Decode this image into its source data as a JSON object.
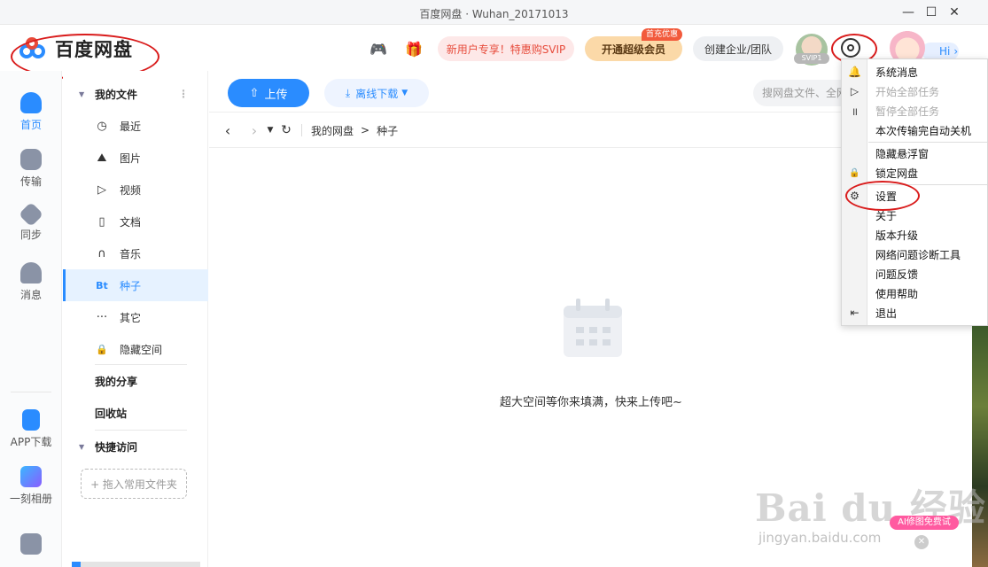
{
  "window": {
    "title": "百度网盘 · Wuhan_20171013"
  },
  "header": {
    "logo_text": "百度网盘",
    "promo_new_user": "新用户专享！特惠购SVIP",
    "svip_button": "开通超级会员",
    "svip_badge": "首充优惠",
    "enterprise_button": "创建企业/团队",
    "vip_level": "SVIP1",
    "hi_label": "Hi"
  },
  "left_nav": {
    "items": [
      {
        "label": "首页",
        "active": true
      },
      {
        "label": "传输"
      },
      {
        "label": "同步"
      },
      {
        "label": "消息"
      }
    ],
    "bottom_items": [
      {
        "label": "APP下载"
      },
      {
        "label": "一刻相册"
      }
    ]
  },
  "tree": {
    "my_files": "我的文件",
    "items": [
      {
        "label": "最近",
        "icon": "clock-icon",
        "glyph": "◷"
      },
      {
        "label": "图片",
        "icon": "image-icon",
        "glyph": "⛰"
      },
      {
        "label": "视频",
        "icon": "play-icon",
        "glyph": "▷"
      },
      {
        "label": "文档",
        "icon": "doc-icon",
        "glyph": "▯"
      },
      {
        "label": "音乐",
        "icon": "headphones-icon",
        "glyph": "∩"
      },
      {
        "label": "种子",
        "icon": "bt-icon",
        "glyph": "Bt",
        "selected": true
      },
      {
        "label": "其它",
        "icon": "more-icon",
        "glyph": "···"
      },
      {
        "label": "隐藏空间",
        "icon": "lock-icon",
        "glyph": "🔒"
      }
    ],
    "my_share": "我的分享",
    "recycle": "回收站",
    "quick_access": "快捷访问",
    "drop_hint": "+ 拖入常用文件夹"
  },
  "toolbar": {
    "upload": "上传",
    "offline_download": "离线下载",
    "search_placeholder": "搜网盘文件、全网"
  },
  "path": {
    "root": "我的网盘",
    "separator": ">",
    "current": "种子"
  },
  "empty": {
    "message": "超大空间等你来填满，快来上传吧~"
  },
  "menu": {
    "items": [
      {
        "label": "系统消息",
        "icon": "bell-icon",
        "glyph": "🔔",
        "disabled": false
      },
      {
        "label": "开始全部任务",
        "icon": "play-icon",
        "glyph": "▷",
        "disabled": true
      },
      {
        "label": "暂停全部任务",
        "icon": "pause-icon",
        "glyph": "॥",
        "disabled": true
      },
      {
        "label": "本次传输完自动关机",
        "icon": "",
        "glyph": "",
        "disabled": false
      },
      {
        "label": "隐藏悬浮窗",
        "icon": "",
        "glyph": "",
        "disabled": false
      },
      {
        "label": "锁定网盘",
        "icon": "lock-icon",
        "glyph": "🔒",
        "disabled": false
      },
      {
        "label": "设置",
        "icon": "gear-icon",
        "glyph": "⚙",
        "disabled": false
      },
      {
        "label": "关于",
        "icon": "",
        "glyph": "",
        "disabled": false
      },
      {
        "label": "版本升级",
        "icon": "",
        "glyph": "",
        "disabled": false
      },
      {
        "label": "网络问题诊断工具",
        "icon": "",
        "glyph": "",
        "disabled": false
      },
      {
        "label": "问题反馈",
        "icon": "",
        "glyph": "",
        "disabled": false
      },
      {
        "label": "使用帮助",
        "icon": "",
        "glyph": "",
        "disabled": false
      },
      {
        "label": "退出",
        "icon": "exit-icon",
        "glyph": "⇤",
        "disabled": false
      }
    ]
  },
  "watermark": {
    "text": "Bai du 经验",
    "url": "jingyan.baidu.com",
    "ai_badge": "AI修图免费试"
  },
  "colors": {
    "accent": "#2a8cff",
    "annotation": "#d91c1c",
    "svip": "#fbd9a8"
  }
}
